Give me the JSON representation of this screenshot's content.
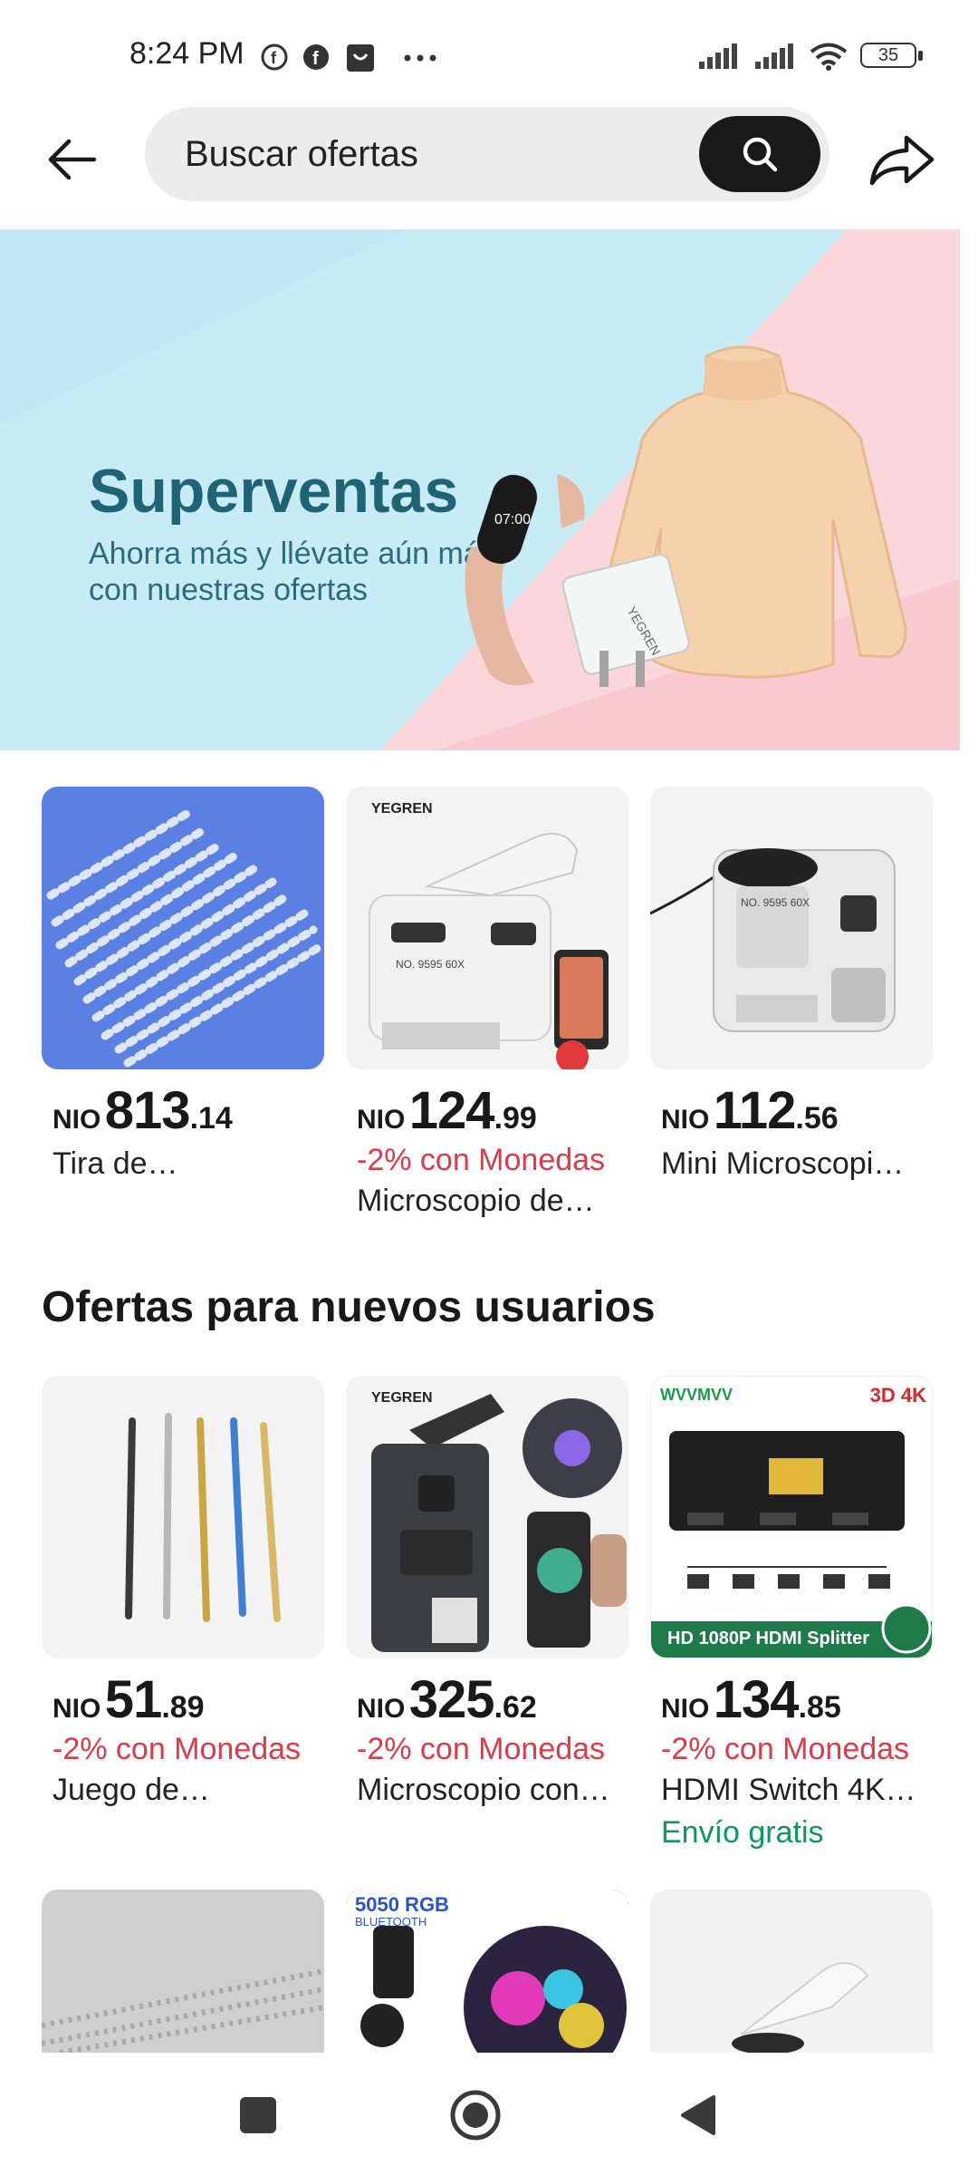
{
  "status": {
    "time": "8:24 PM",
    "battery": "35"
  },
  "search": {
    "placeholder": "Buscar ofertas"
  },
  "banner": {
    "title": "Superventas",
    "subtitle": "Ahorra más y llévate aún más con nuestras ofertas",
    "band_label": "YEGREN",
    "watch_time": "07:00"
  },
  "top_products": [
    {
      "currency": "NIO",
      "price_int": "813",
      "price_dec": ".14",
      "coins": "",
      "title": "Tira de…",
      "shipping": ""
    },
    {
      "currency": "NIO",
      "price_int": "124",
      "price_dec": ".99",
      "coins": "-2% con Monedas",
      "title": "Microscopio de…",
      "shipping": "",
      "brand": "YEGREN",
      "model": "NO. 9595 60X"
    },
    {
      "currency": "NIO",
      "price_int": "112",
      "price_dec": ".56",
      "coins": "",
      "title": "Mini Microscopi…",
      "shipping": "",
      "model": "NO. 9595 60X"
    }
  ],
  "new_users": {
    "title": "Ofertas para nuevos usuarios",
    "products": [
      {
        "currency": "NIO",
        "price_int": "51",
        "price_dec": ".89",
        "coins": "-2% con Monedas",
        "title": "Juego de…",
        "shipping": ""
      },
      {
        "currency": "NIO",
        "price_int": "325",
        "price_dec": ".62",
        "coins": "-2% con Monedas",
        "title": "Microscopio con…",
        "shipping": "",
        "brand": "YEGREN"
      },
      {
        "currency": "NIO",
        "price_int": "134",
        "price_dec": ".85",
        "coins": "-2% con Monedas",
        "title": "HDMI Switch 4K…",
        "shipping": "Envío gratis",
        "brand": "WVVMVV",
        "badge": "3D 4K",
        "strip": "HD 1080P HDMI Splitter"
      }
    ]
  },
  "peek": {
    "rgb_title": "5050 RGB",
    "rgb_sub": "BLUETOOTH"
  },
  "colors": {
    "accent_red": "#e0394a",
    "free_shipping_green": "#0b9a5a",
    "banner_title": "#1f6475"
  },
  "icons": [
    "back-arrow-icon",
    "search-icon",
    "share-icon",
    "square-icon",
    "home-circle-icon",
    "triangle-back-icon"
  ]
}
